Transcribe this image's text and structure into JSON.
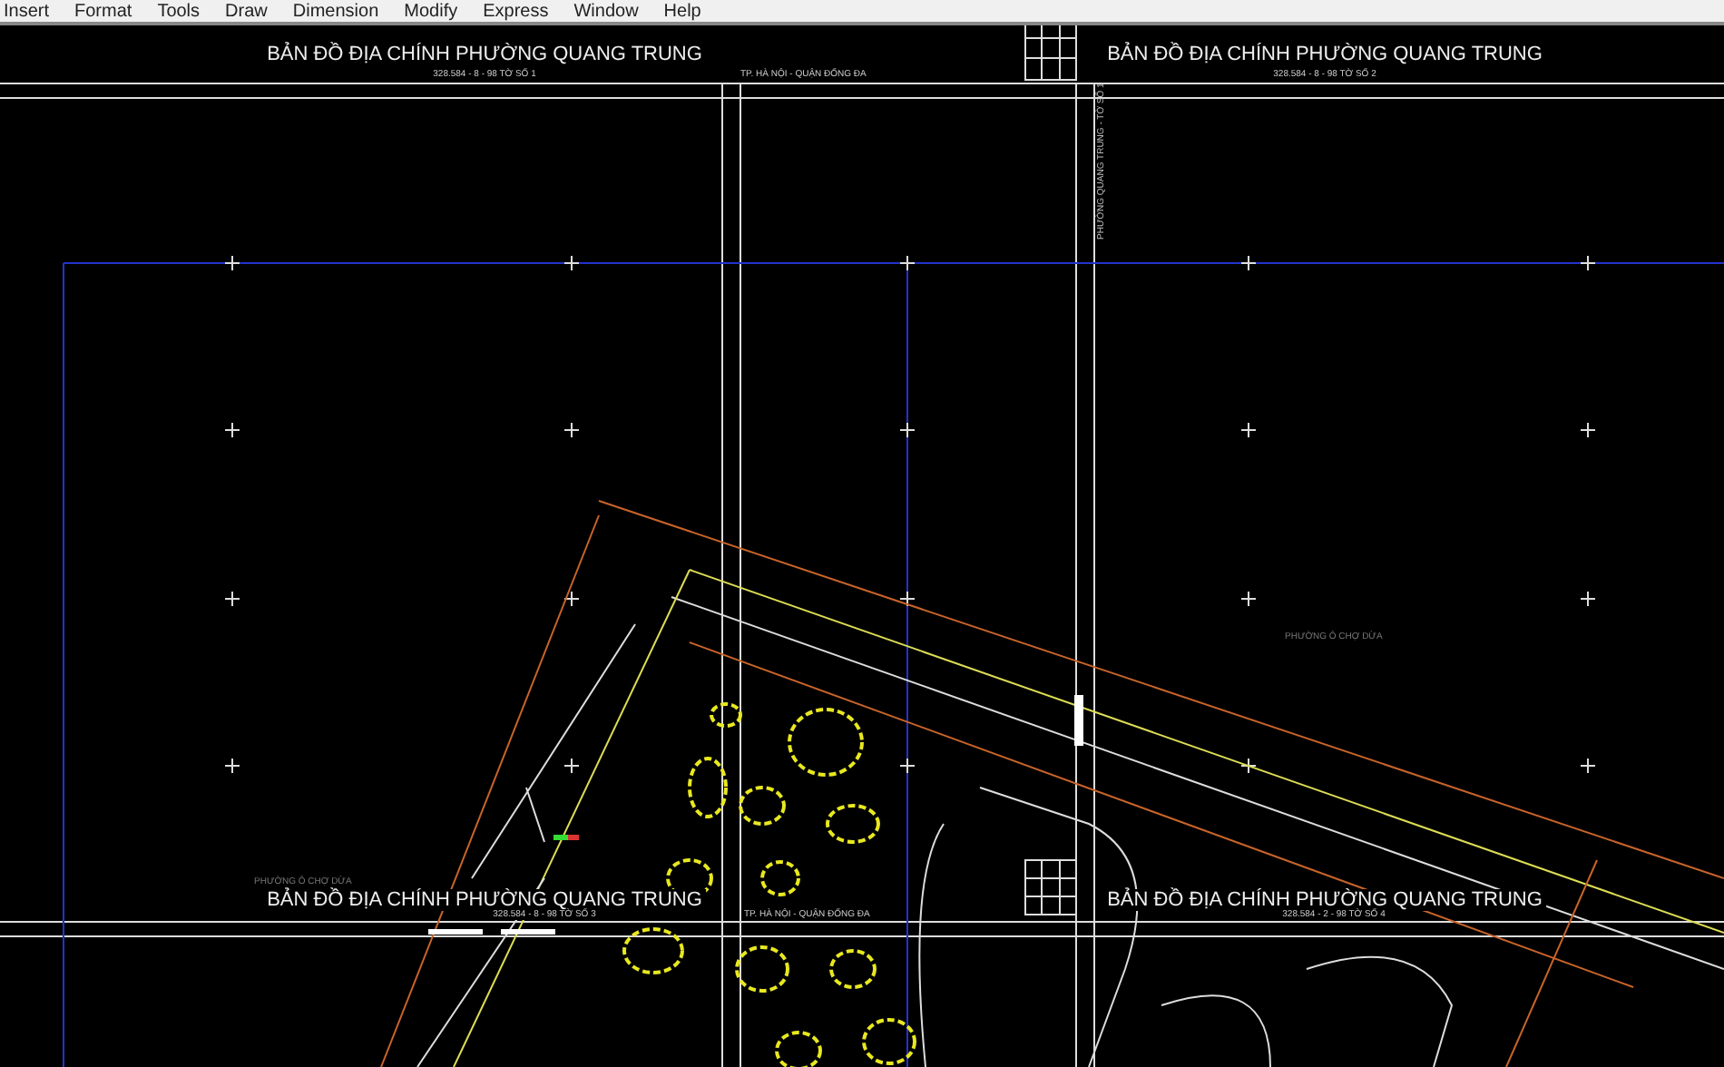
{
  "menu_bar": [
    "Insert",
    "Format",
    "Tools",
    "Draw",
    "Dimension",
    "Modify",
    "Express",
    "Window",
    "Help"
  ],
  "sheets": [
    {
      "title": "BẢN ĐỒ ĐỊA CHÍNH PHƯỜNG QUANG TRUNG",
      "sheet_number": "328.584 - 8 - 98 TỜ SỐ 1",
      "city": "TP. HÀ NỘI - QUẬN ĐỐNG ĐA"
    },
    {
      "title": "BẢN ĐỒ ĐỊA CHÍNH PHƯỜNG QUANG TRUNG",
      "sheet_number": "328.584 - 8 - 98 TỜ SỐ 2"
    },
    {
      "title": "BẢN ĐỒ ĐỊA CHÍNH PHƯỜNG QUANG TRUNG",
      "sheet_number": "328.584 - 8 - 98 TỜ SỐ 3",
      "city": "TP. HÀ NỘI - QUẬN ĐỐNG ĐA"
    },
    {
      "title": "BẢN ĐỒ ĐỊA CHÍNH PHƯỜNG QUANG TRUNG",
      "sheet_number": "328.584 - 2 - 98 TỜ SỐ 4"
    }
  ],
  "map_labels": [
    {
      "kind": "vertical",
      "text": "PHƯỜNG QUANG TRUNG - TỜ SỐ 1"
    },
    {
      "kind": "area",
      "text": "PHƯỜNG Ô CHỢ DỪA"
    },
    {
      "kind": "area",
      "text": "PHƯỜNG Ô CHỢ DỪA"
    }
  ]
}
